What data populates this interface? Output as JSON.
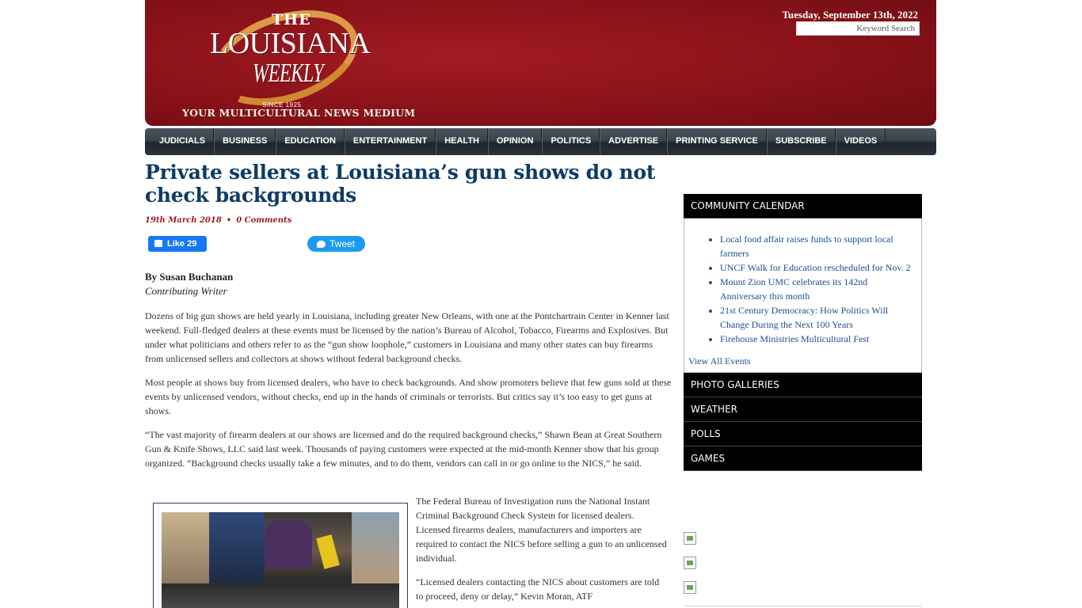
{
  "header": {
    "logo": {
      "the": "THE",
      "name": "LOUISIANA",
      "weekly": "WEEKLY",
      "since": "SINCE 1925"
    },
    "tagline": "YOUR MULTICULTURAL NEWS MEDIUM",
    "date": "Tuesday, September 13th, 2022",
    "search_placeholder": "Keyword Search"
  },
  "nav": {
    "items": [
      "JUDICIALS",
      "BUSINESS",
      "EDUCATION",
      "ENTERTAINMENT",
      "HEALTH",
      "OPINION",
      "POLITICS",
      "ADVERTISE",
      "PRINTING SERVICE",
      "SUBSCRIBE",
      "VIDEOS"
    ]
  },
  "article": {
    "title": "Private sellers at Louisiana’s gun shows do not check backgrounds",
    "date": "19th March 2018",
    "separator": "•",
    "comments": "0 Comments",
    "facebook": {
      "label": "Like",
      "count": "29"
    },
    "twitter": {
      "label": "Tweet"
    },
    "byline": "By Susan Buchanan",
    "role": "Contributing Writer",
    "paragraphs": [
      "Dozens of big gun shows are held yearly in Louisiana, including greater New Orleans, with one at the Pontchartrain Center in Kenner last weekend. Full-fledged dealers at these events must be licensed by the nation’s Bureau of Alcohol, Tobacco, Firearms and Explosives. But under what politicians and others refer to as the “gun show loophole,” customers in Louisiana and many other states can buy firearms from unlicensed sellers and collectors at shows without federal background checks.",
      "Most people at shows buy from licensed dealers, who have to check backgrounds. And show promoters believe that few guns sold at these events by unlicensed vendors, without checks, end up in the hands of criminals or terrorists. But critics say it’s too easy to get guns at shows.",
      "“The vast majority of firearm dealers at our shows are licensed and do the required background checks,” Shawn Bean at Great Southern Gun & Knife Shows, LLC said last week. Thousands of paying customers were expected at the mid-month Kenner show that his group organized. “Background checks usually take a few minutes, and to do them, vendors can call in or go online to the NICS,” he said.",
      "The Federal Bureau of Investigation runs the National Instant Criminal Background Check System for licensed dealers. Licensed firearms dealers, manufacturers and importers are required to contact the NICS before selling a gun to an unlicensed individual.",
      "“Licensed dealers contacting the NICS about customers are told to proceed, deny or delay,” Kevin Moran, ATF"
    ]
  },
  "sidebar": {
    "calendar_title": "COMMUNITY CALENDAR",
    "events": [
      "Local food affair raises funds to support local farmers",
      "UNCF Walk for Education rescheduled for Nov. 2",
      "Mount Zion UMC celebrates its 142nd Anniversary this month",
      "21st Century Democracy: How Politics Will Change During the Next 100 Years",
      "Firehouse Ministries Multicultural Fest"
    ],
    "view_all": "View All Events",
    "sections": [
      "PHOTO GALLERIES",
      "WEATHER",
      "POLLS",
      "GAMES"
    ]
  }
}
